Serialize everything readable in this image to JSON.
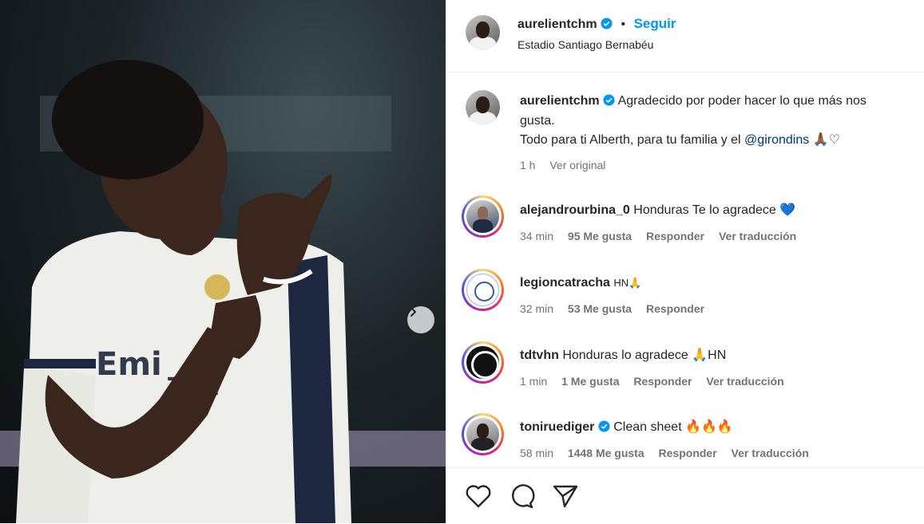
{
  "post": {
    "author": "aurelientchm",
    "follow_label": "Seguir",
    "separator": "•",
    "location": "Estadio Santiago Bernabéu"
  },
  "caption": {
    "username": "aurelientchm",
    "line1": "Agradecido por poder hacer lo que más nos",
    "line2": "gusta.",
    "line3_prefix": "Todo para ti Alberth, para tu familia y el",
    "mention": "@girondins",
    "emojis": "🙏🏾♡",
    "time": "1 h",
    "see_original": "Ver original"
  },
  "comments": [
    {
      "username": "alejandrourbina_0",
      "verified": false,
      "text": "Honduras Te lo agradece 💙",
      "time": "34 min",
      "likes": "95 Me gusta",
      "reply": "Responder",
      "translate": "Ver traducción"
    },
    {
      "username": "legioncatracha",
      "verified": false,
      "text": "HN🙏",
      "time": "32 min",
      "likes": "53 Me gusta",
      "reply": "Responder",
      "translate": ""
    },
    {
      "username": "tdtvhn",
      "verified": false,
      "text": "Honduras lo agradece 🙏HN",
      "time": "1 min",
      "likes": "1 Me gusta",
      "reply": "Responder",
      "translate": "Ver traducción"
    },
    {
      "username": "toniruediger",
      "verified": true,
      "text": "Clean sheet 🔥🔥🔥",
      "time": "58 min",
      "likes": "1448 Me gusta",
      "reply": "Responder",
      "translate": "Ver traducción"
    }
  ],
  "icons": {
    "like": "heart-icon",
    "comment": "comment-icon",
    "share": "send-icon",
    "next": "chevron-right-icon",
    "verified": "verified-badge-icon"
  },
  "colors": {
    "follow": "#0095f6",
    "verified": "#0095f6",
    "meta": "#737373",
    "mention": "#00376b"
  }
}
